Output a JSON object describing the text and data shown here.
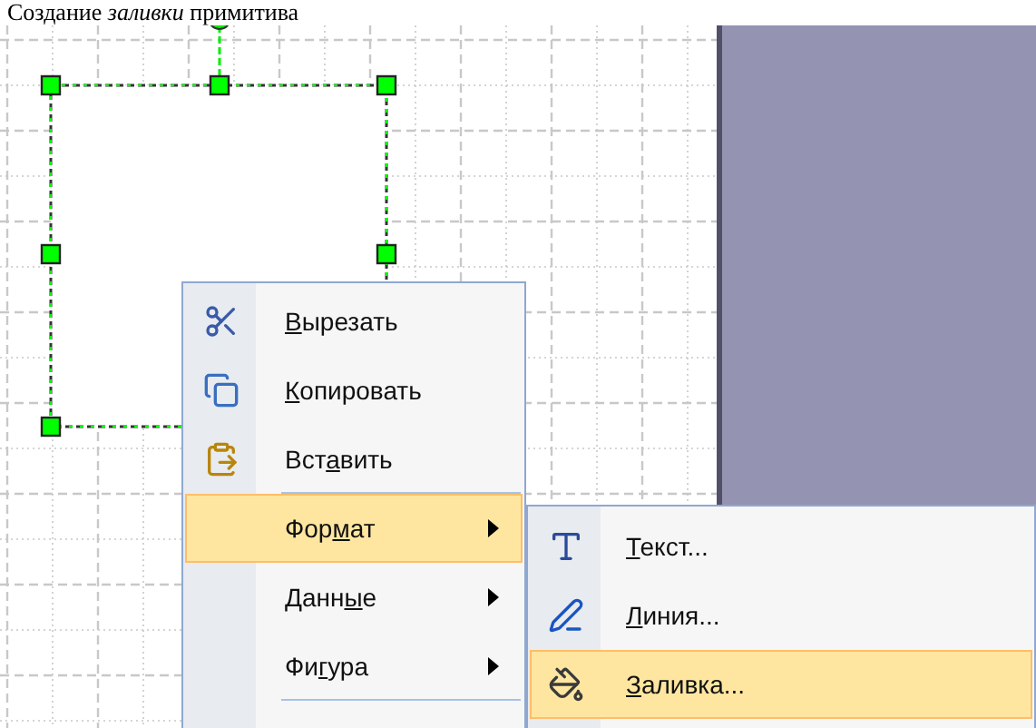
{
  "caption": "Создание *заливки* примитива",
  "context_menu": {
    "items": [
      {
        "label": {
          "key": "В",
          "after": "ырезать"
        },
        "selected": false,
        "has_submenu": false,
        "separator_after": false
      },
      {
        "label": {
          "key": "К",
          "after": "опировать"
        },
        "selected": false,
        "has_submenu": false,
        "separator_after": false
      },
      {
        "label": {
          "before": "Вст",
          "key": "а",
          "after": "вить"
        },
        "selected": false,
        "has_submenu": false,
        "separator_after": true
      },
      {
        "label": {
          "before": "Фор",
          "key": "м",
          "after": "ат"
        },
        "selected": true,
        "has_submenu": true,
        "separator_after": false
      },
      {
        "label": {
          "before": "Данн",
          "key": "ы",
          "after": "е"
        },
        "selected": false,
        "has_submenu": true,
        "separator_after": false
      },
      {
        "label": {
          "before": "Фи",
          "key": "г",
          "after": "ура"
        },
        "selected": false,
        "has_submenu": true,
        "separator_after": true
      }
    ]
  },
  "submenu": {
    "items": [
      {
        "label": {
          "key": "Т",
          "after": "екст..."
        },
        "selected": false
      },
      {
        "label": {
          "key": "Л",
          "after": "иния..."
        },
        "selected": false
      },
      {
        "label": {
          "key": "З",
          "after": "аливка..."
        },
        "selected": true
      }
    ]
  }
}
